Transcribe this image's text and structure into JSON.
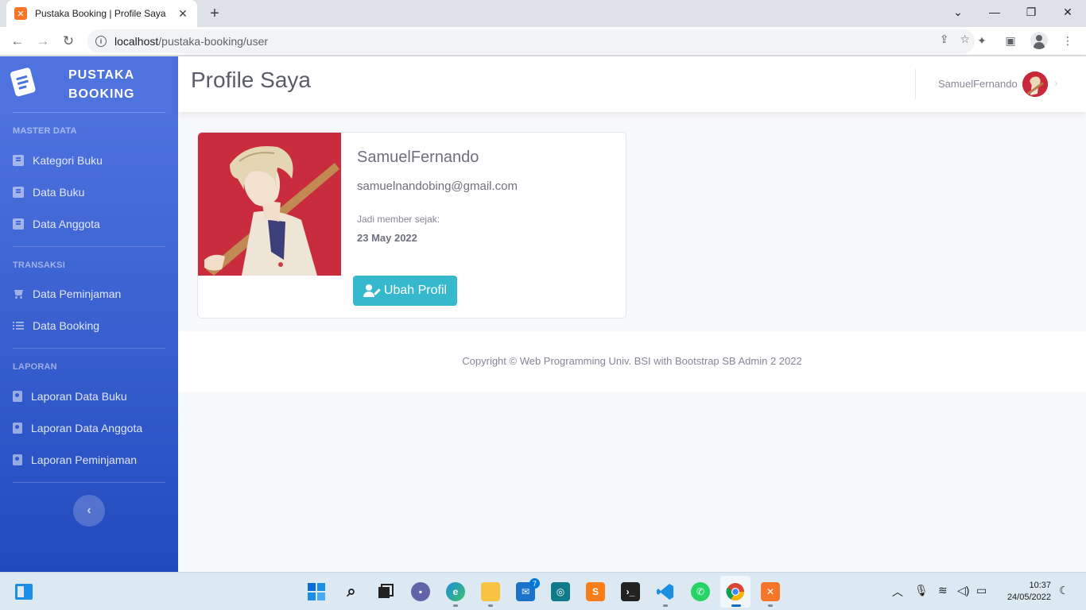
{
  "browser": {
    "tab_title": "Pustaka Booking | Profile Saya",
    "url_host": "localhost",
    "url_path": "/pustaka-booking/user"
  },
  "sidebar": {
    "brand_line1": "PUSTAKA",
    "brand_line2": "BOOKING",
    "sections": [
      {
        "heading": "MASTER DATA",
        "items": [
          {
            "label": "Kategori Buku",
            "icon": "book-icon"
          },
          {
            "label": "Data Buku",
            "icon": "book-icon"
          },
          {
            "label": "Data Anggota",
            "icon": "book-icon"
          }
        ]
      },
      {
        "heading": "TRANSAKSI",
        "items": [
          {
            "label": "Data Peminjaman",
            "icon": "cart-icon"
          },
          {
            "label": "Data Booking",
            "icon": "list-icon"
          }
        ]
      },
      {
        "heading": "LAPORAN",
        "items": [
          {
            "label": "Laporan Data Buku",
            "icon": "address-book-icon"
          },
          {
            "label": "Laporan Data Anggota",
            "icon": "address-book-icon"
          },
          {
            "label": "Laporan Peminjaman",
            "icon": "address-book-icon"
          }
        ]
      }
    ]
  },
  "topbar": {
    "page_title": "Profile Saya",
    "user_name": "SamuelFernando"
  },
  "profile": {
    "name": "SamuelFernando",
    "email": "samuelnandobing@gmail.com",
    "member_since_label": "Jadi member sejak:",
    "member_since_date": "23 May 2022",
    "edit_button": "Ubah Profil"
  },
  "footer": {
    "copyright": "Copyright © Web Programming Univ. BSI with Bootstrap SB Admin 2 2022"
  },
  "taskbar": {
    "time": "10:37",
    "date": "24/05/2022",
    "mail_badge": "7"
  },
  "colors": {
    "sidebar_start": "#4e73df",
    "sidebar_end": "#224abe",
    "button_info": "#36b9cc"
  }
}
